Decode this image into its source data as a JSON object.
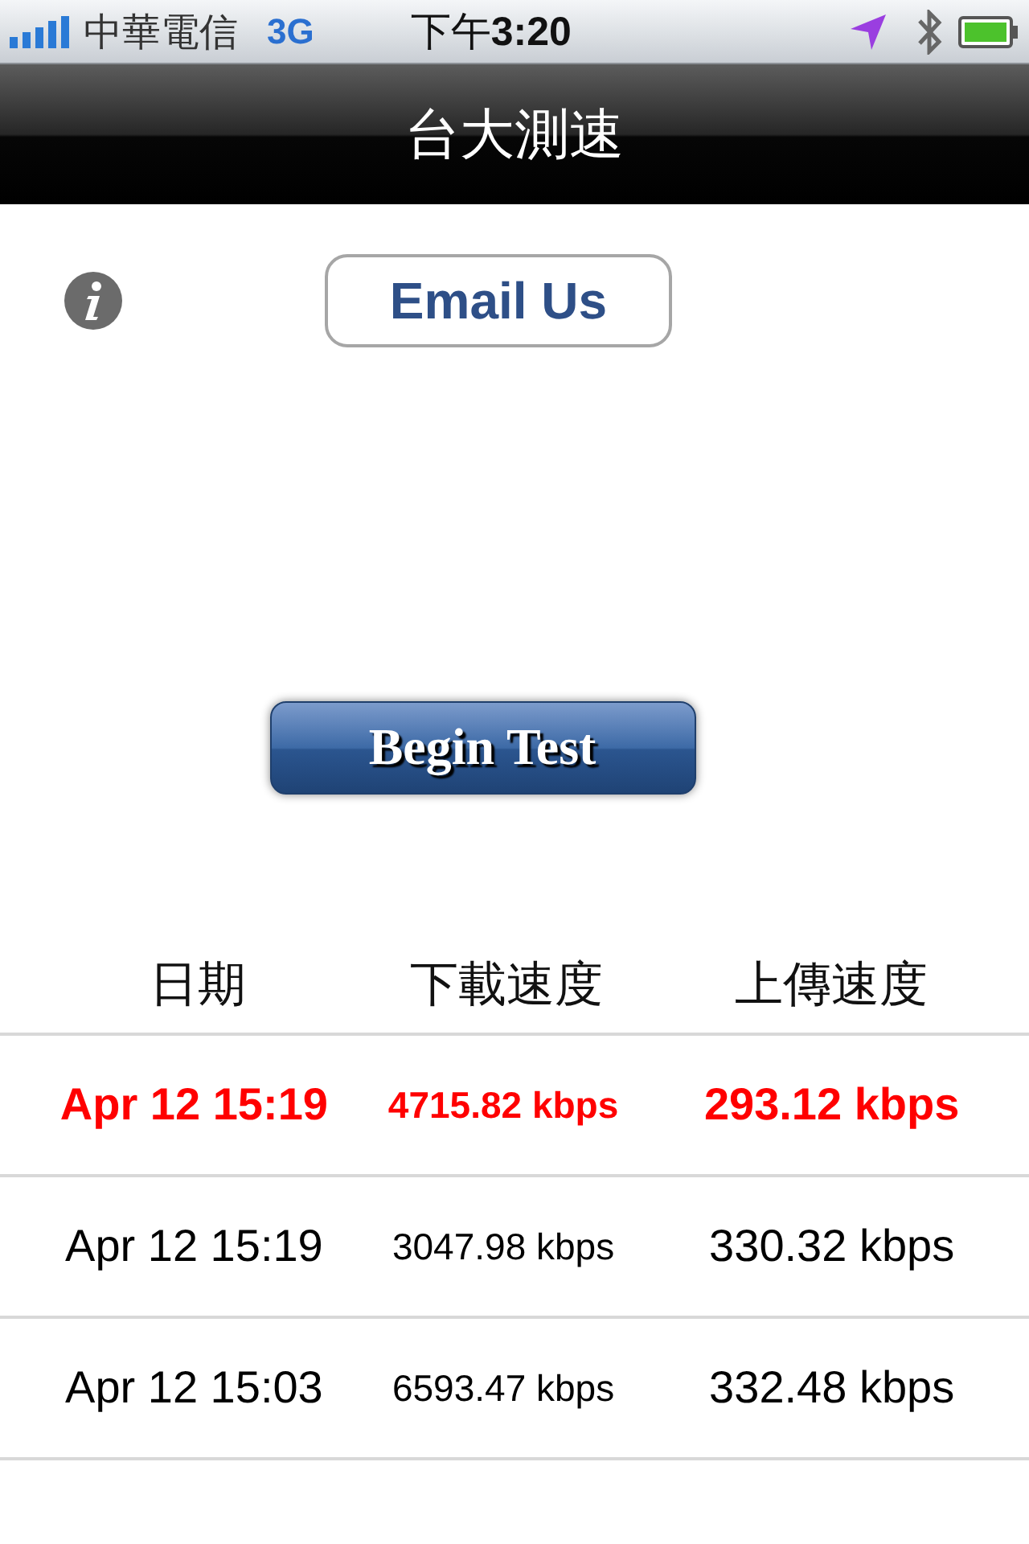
{
  "status_bar": {
    "carrier": "中華電信",
    "network": "3G",
    "time_prefix": "下午",
    "time": "3:20"
  },
  "nav_bar": {
    "title": "台大測速"
  },
  "buttons": {
    "email": "Email Us",
    "begin": "Begin Test"
  },
  "table": {
    "columns": [
      "日期",
      "下載速度",
      "上傳速度"
    ],
    "rows": [
      {
        "date": "Apr 12 15:19",
        "download": "4715.82 kbps",
        "upload": "293.12 kbps",
        "highlighted": true
      },
      {
        "date": "Apr 12 15:19",
        "download": "3047.98 kbps",
        "upload": "330.32 kbps",
        "highlighted": false
      },
      {
        "date": "Apr 12 15:03",
        "download": "6593.47 kbps",
        "upload": "332.48 kbps",
        "highlighted": false
      }
    ]
  }
}
